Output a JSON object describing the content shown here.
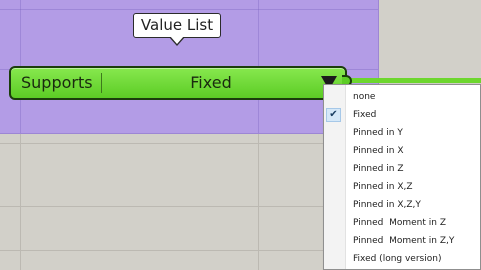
{
  "tooltip": {
    "text": "Value List"
  },
  "component": {
    "name": "Supports",
    "selected_value": "Fixed",
    "accent_color": "#6dd62e",
    "group_color": "#b39ce6"
  },
  "icons": {
    "dropdown": "dropdown-triangle-icon",
    "check": "checkmark-icon"
  },
  "menu": {
    "items": [
      {
        "label": "none",
        "checked": false
      },
      {
        "label": "Fixed",
        "checked": true
      },
      {
        "label": "Pinned in Y",
        "checked": false
      },
      {
        "label": "Pinned in X",
        "checked": false
      },
      {
        "label": "Pinned in Z",
        "checked": false
      },
      {
        "label": "Pinned in X,Z",
        "checked": false
      },
      {
        "label": "Pinned in X,Z,Y",
        "checked": false
      },
      {
        "label": "Pinned  Moment in Z",
        "checked": false
      },
      {
        "label": "Pinned  Moment in Z,Y",
        "checked": false
      },
      {
        "label": "Fixed (long version)",
        "checked": false
      }
    ],
    "check_glyph": "✔"
  }
}
